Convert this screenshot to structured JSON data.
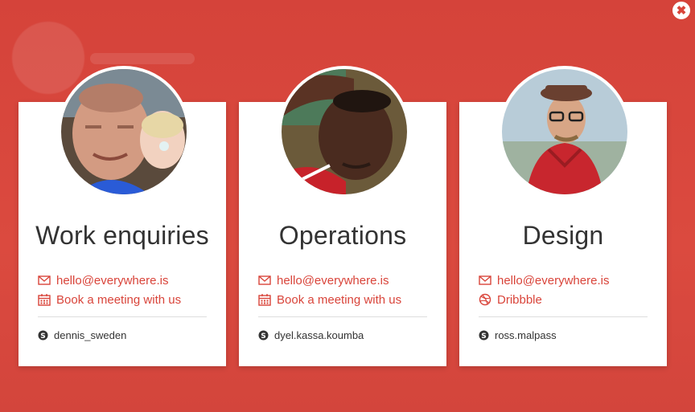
{
  "close": {
    "label": "✖"
  },
  "cards": [
    {
      "title": "Work enquiries",
      "email": "hello@everywhere.is",
      "second_link": {
        "label": "Book a meeting with us",
        "icon": "calendar-icon"
      },
      "skype": "dennis_sweden"
    },
    {
      "title": "Operations",
      "email": "hello@everywhere.is",
      "second_link": {
        "label": "Book a meeting with us",
        "icon": "calendar-icon"
      },
      "skype": "dyel.kassa.koumba"
    },
    {
      "title": "Design",
      "email": "hello@everywhere.is",
      "second_link": {
        "label": "Dribbble",
        "icon": "dribbble-icon"
      },
      "skype": "ross.malpass"
    }
  ],
  "colors": {
    "accent": "#d9443a",
    "card": "#ffffff",
    "text": "#333333"
  }
}
